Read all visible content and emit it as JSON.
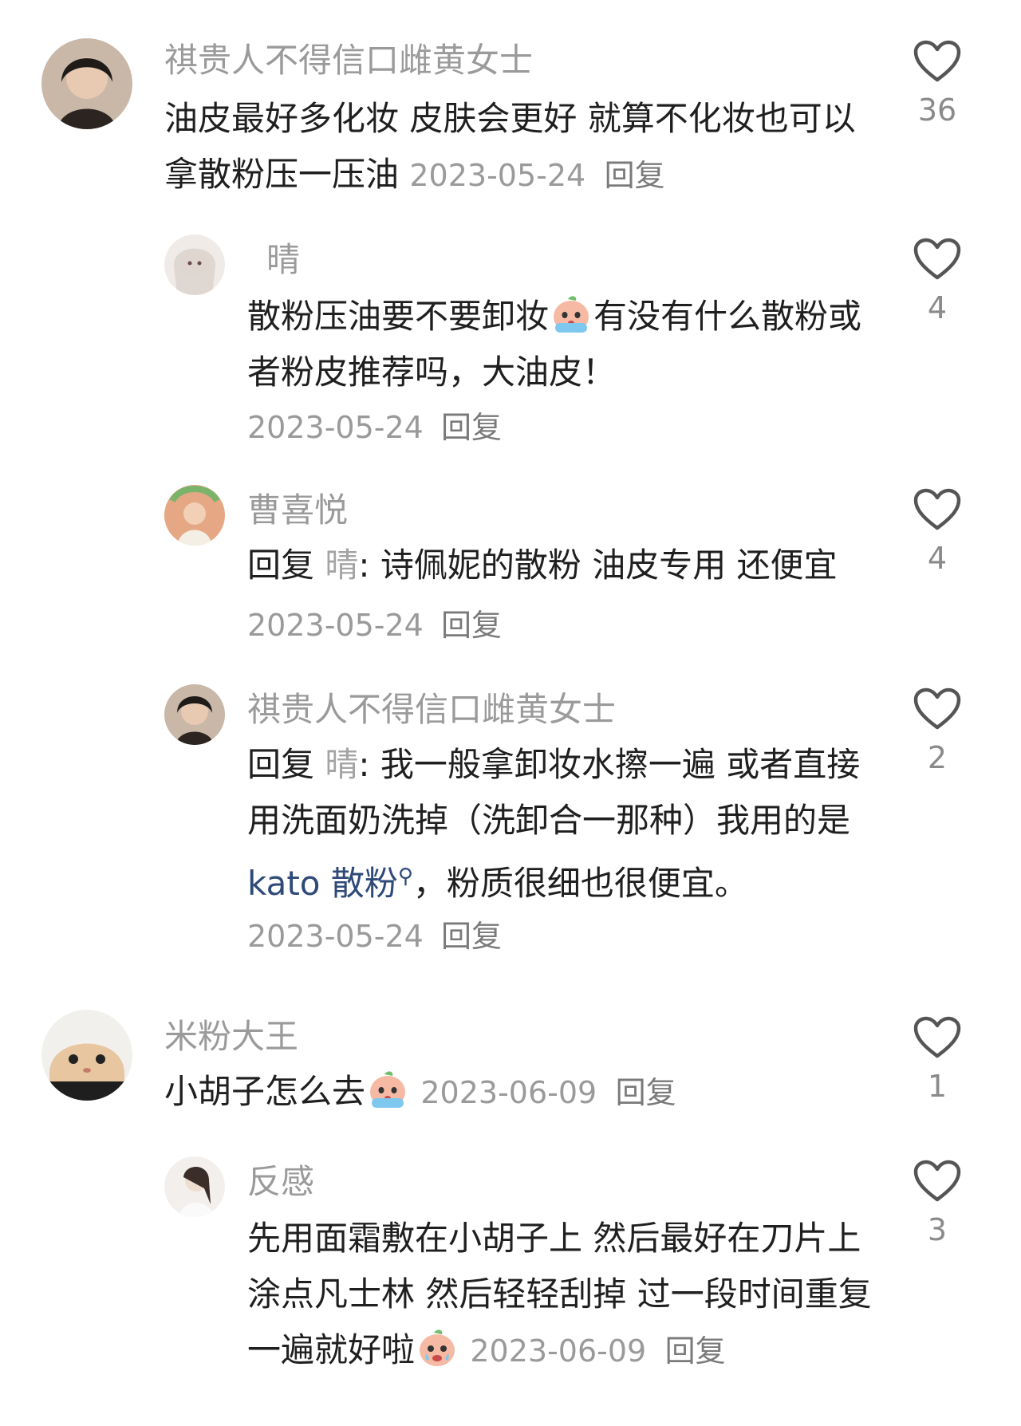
{
  "comments": [
    {
      "username": "祺贵人不得信口雌黄女士",
      "text": "油皮最好多化妆 皮肤会更好 就算不化妆也可以拿散粉压一压油",
      "date": "2023-05-24",
      "reply_label": "回复",
      "likes": "36"
    },
    {
      "username": "晴",
      "text_before_emoji": "散粉压油要不要卸妆",
      "emoji": "crying-peach-emoji",
      "text_after_emoji": "有没有什么散粉或者粉皮推荐吗，大油皮！",
      "date": "2023-05-24",
      "reply_label": "回复",
      "likes": "4"
    },
    {
      "username": "曹喜悦",
      "reply_prefix": "回复",
      "reply_to": "晴",
      "text": ": 诗佩妮的散粉 油皮专用 还便宜",
      "date": "2023-05-24",
      "reply_label": "回复",
      "likes": "4"
    },
    {
      "username": "祺贵人不得信口雌黄女士",
      "reply_prefix": "回复",
      "reply_to": "晴",
      "text": ": 我一般拿卸妆水擦一遍 或者直接用洗面奶洗掉（洗卸合一那种）我用的是",
      "link": "kato 散粉",
      "text_after": "，粉质很细也很便宜。",
      "date": "2023-05-24",
      "reply_label": "回复",
      "likes": "2"
    },
    {
      "username": "米粉大王",
      "text": "小胡子怎么去",
      "emoji": "crying-peach-emoji",
      "date": "2023-06-09",
      "reply_label": "回复",
      "likes": "1"
    },
    {
      "username": "反感",
      "text": "先用面霜敷在小胡子上 然后最好在刀片上涂点凡士林 然后轻轻刮掉 过一段时间重复一遍就好啦",
      "emoji": "sobbing-peach-emoji",
      "date": "2023-06-09",
      "reply_label": "回复",
      "likes": "3"
    }
  ],
  "colors": {
    "username": "#9a9a9a",
    "text": "#1f1f1f",
    "link": "#2e4a78",
    "meta": "#9a9a9a"
  }
}
